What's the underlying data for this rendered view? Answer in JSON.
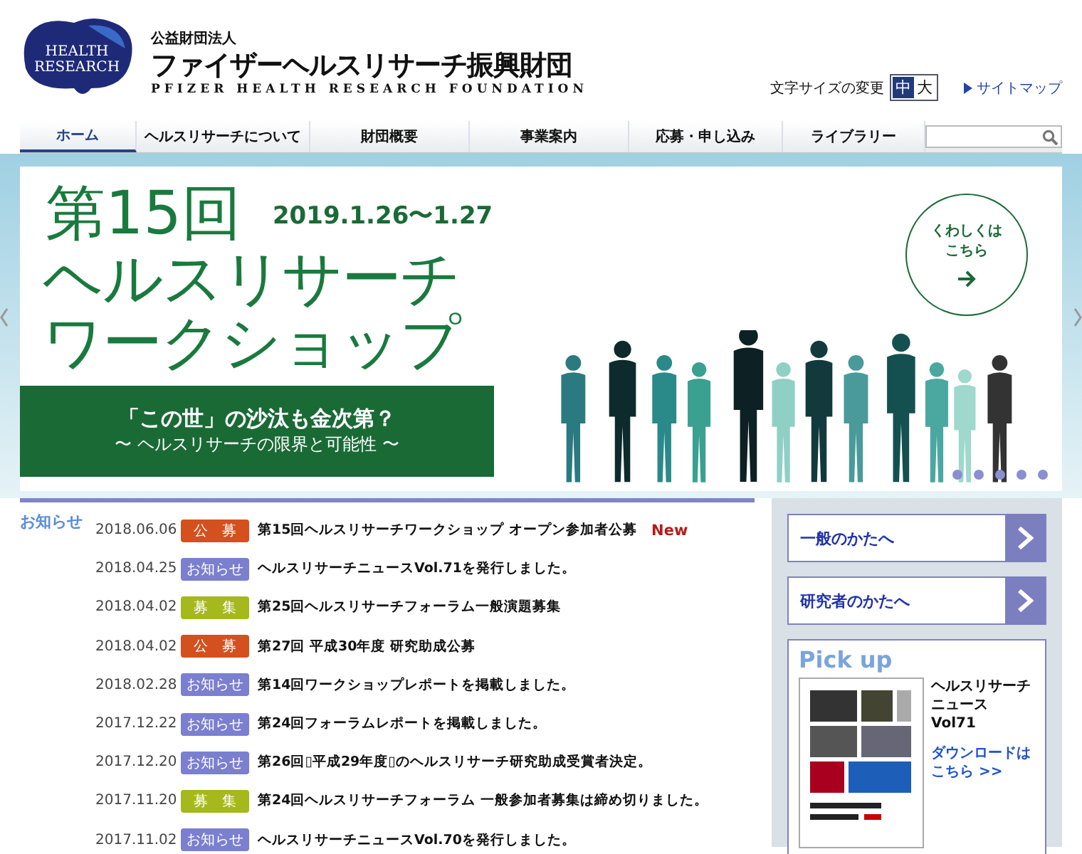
{
  "header": {
    "org_type": "公益財団法人",
    "org_name": "ファイザーヘルスリサーチ振興財団",
    "org_name_en": "PFIZER HEALTH RESEARCH FOUNDATION",
    "logo_text": [
      "HEALTH",
      "RESEARCH"
    ],
    "font_size_label": "文字サイズの変更",
    "font_sizes": [
      {
        "label": "中",
        "selected": true
      },
      {
        "label": "大",
        "selected": false
      }
    ],
    "sitemap": "サイトマップ"
  },
  "nav": [
    {
      "label": "ホーム",
      "selected": true
    },
    {
      "label": "ヘルスリサーチについて",
      "selected": false
    },
    {
      "label": "財団概要",
      "selected": false
    },
    {
      "label": "事業案内",
      "selected": false
    },
    {
      "label": "応募・申し込み",
      "selected": false
    },
    {
      "label": "ライブラリー",
      "selected": false
    }
  ],
  "banner": {
    "title_1": "第15回",
    "date": "2019.1.26〜1.27",
    "title_2": "ヘルスリサーチ",
    "title_3": "ワークショップ",
    "theme": "「この世」の沙汰も金次第？",
    "subtitle": "〜 ヘルスリサーチの限界と可能性 〜",
    "details_button": [
      "くわしくは",
      "こちら"
    ],
    "dots": [
      {
        "selected": false
      },
      {
        "selected": false
      },
      {
        "selected": false
      },
      {
        "selected": false
      },
      {
        "selected": false
      }
    ]
  },
  "news": {
    "heading": "お知らせ",
    "items": [
      {
        "date": "2018.06.06",
        "tag": "公　募",
        "color": "#d4501e",
        "title": "第15回ヘルスリサーチワークショップ オープン参加者公募",
        "badge": "New"
      },
      {
        "date": "2018.04.25",
        "tag": "お知らせ",
        "color": "#7b7fd0",
        "title": "ヘルスリサーチニュースVol.71を発行しました。"
      },
      {
        "date": "2018.04.02",
        "tag": "募　集",
        "color": "#a5b81c",
        "title": "第25回ヘルスリサーチフォーラム一般演題募集"
      },
      {
        "date": "2018.04.02",
        "tag": "公　募",
        "color": "#d4501e",
        "title": "第27回 平成30年度 研究助成公募"
      },
      {
        "date": "2018.02.28",
        "tag": "お知らせ",
        "color": "#7b7fd0",
        "title": "第14回ワークショップレポートを掲載しました。"
      },
      {
        "date": "2017.12.22",
        "tag": "お知らせ",
        "color": "#7b7fd0",
        "title": "第24回フォーラムレポートを掲載しました。"
      },
      {
        "date": "2017.12.20",
        "tag": "お知らせ",
        "color": "#7b7fd0",
        "title": "第26回▯平成29年度▯のヘルスリサーチ研究助成受賞者決定。"
      },
      {
        "date": "2017.11.20",
        "tag": "募　集",
        "color": "#a5b81c",
        "title": "第24回ヘルスリサーチフォーラム 一般参加者募集は締め切りました。"
      },
      {
        "date": "2017.11.02",
        "tag": "お知らせ",
        "color": "#7b7fd0",
        "title": "ヘルスリサーチニュースVol.70を発行しました。"
      }
    ]
  },
  "sidebar": {
    "links": [
      "一般のかたへ",
      "研究者のかたへ"
    ],
    "pickup": {
      "heading": "Pick up",
      "title": "ヘルスリサーチニュース Vol71",
      "download": "ダウンロードはこちら >>"
    }
  }
}
